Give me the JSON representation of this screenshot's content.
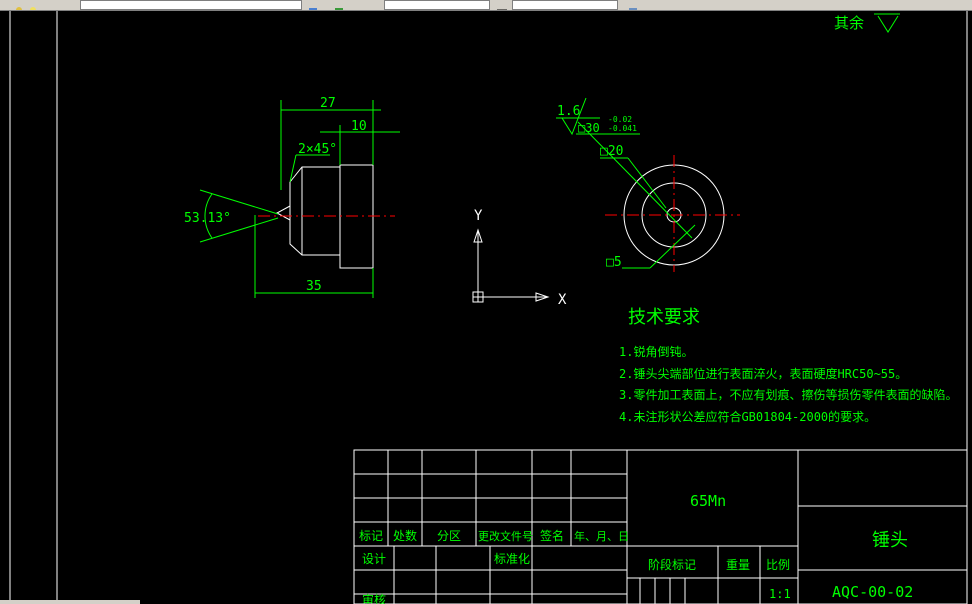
{
  "colors": {
    "background": "#000000",
    "outline": "#ffffff",
    "dimension": "#00ff00",
    "centerline": "#ff0000",
    "text": "#00ff00",
    "toolbar": "#d4d0c8"
  },
  "toolbar": {
    "layer_box_text": "",
    "linetype_box_text": "",
    "lineweight_box_text": ""
  },
  "drawing": {
    "surface_roughness_rest": "其余",
    "side_view": {
      "dim_top_overall": "27",
      "dim_top_step": "10",
      "dim_chamfer": "2×45°",
      "dim_angle": "53.13°",
      "dim_bottom_overall": "35"
    },
    "front_view": {
      "roughness_value": "1.6",
      "dim_square_outer": "□30",
      "tol_upper": "-0.02",
      "tol_lower": "-0.041",
      "dim_square_mid": "□20",
      "dim_square_inner": "□5"
    },
    "ucs": {
      "y_label": "Y",
      "x_label": "X"
    },
    "tech_requirements": {
      "title": "技术要求",
      "items": [
        "1.锐角倒钝。",
        "2.锤头尖端部位进行表面淬火，表面硬度HRC50~55。",
        "3.零件加工表面上，不应有划痕、擦伤等损伤零件表面的缺陷。",
        "4.未注形状公差应符合GB01804-2000的要求。"
      ]
    },
    "title_block": {
      "material": "65Mn",
      "part_name": "锤头",
      "drawing_number": "AQC-00-02",
      "scale_label": "比例",
      "scale_value": "1:1",
      "weight_label": "重量",
      "stage_label": "阶段标记",
      "header_cols": [
        "标记",
        "处数",
        "分区",
        "更改文件号",
        "签名",
        "年、月、日"
      ],
      "design_label": "设计",
      "standardize_label": "标准化",
      "process_label": "审核"
    }
  }
}
